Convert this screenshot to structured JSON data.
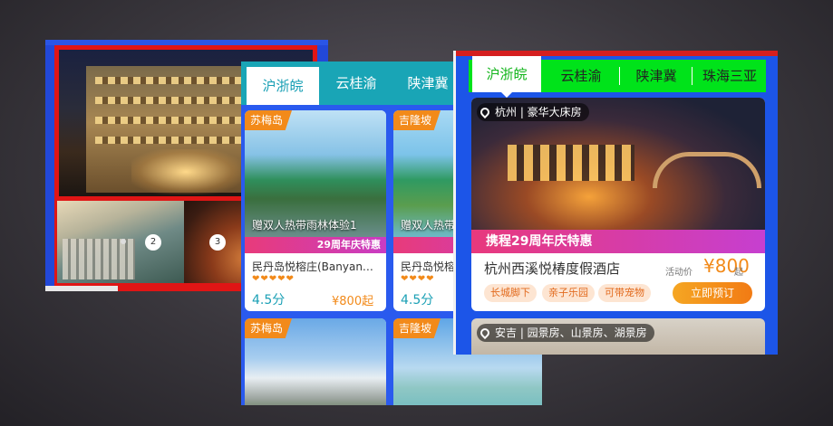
{
  "panel1": {
    "slider_indicators": [
      "2",
      "3"
    ]
  },
  "panel2": {
    "tabs": [
      {
        "label": "沪浙皖",
        "active": true
      },
      {
        "label": "云桂渝",
        "active": false
      },
      {
        "label": "陕津冀",
        "active": false
      }
    ],
    "cards": [
      {
        "tag": "苏梅岛",
        "overlay": "赠双人热带雨林体验1",
        "promo": "29周年庆特惠",
        "name": "民丹岛悦榕庄(Banyan…",
        "rating_hearts": "❤❤❤❤❤",
        "score": "4.5分",
        "price": "¥800起"
      },
      {
        "tag": "吉隆坡",
        "overlay": "赠双人热带",
        "promo": "",
        "name": "民丹岛悦榕",
        "rating_hearts": "❤❤❤❤",
        "score": "4.5分",
        "price": ""
      },
      {
        "tag": "苏梅岛"
      },
      {
        "tag": "吉隆坡"
      }
    ]
  },
  "panel3": {
    "tabs": [
      {
        "label": "沪浙皖",
        "active": true
      },
      {
        "label": "云桂渝",
        "active": false
      },
      {
        "label": "陕津冀",
        "active": false
      },
      {
        "label": "珠海三亚",
        "active": false
      }
    ],
    "card": {
      "location": "杭州 | 豪华大床房",
      "promo": "携程29周年庆特惠",
      "name": "杭州西溪悦椿度假酒店",
      "activity_label": "活动价",
      "price": "¥800",
      "price_suffix": "起",
      "tags": [
        "长城脚下",
        "亲子乐园",
        "可带宠物"
      ],
      "book_label": "立即预订"
    },
    "card2": {
      "location": "安吉 | 园景房、山景房、湖景房"
    }
  },
  "colors": {
    "blue": "#2a5aee",
    "teal_tab": "#19a5b6",
    "green_tab": "#00e31a",
    "orange": "#f28a1a",
    "red_border": "#e01515",
    "promo_pink": "#e8397c"
  },
  "icons": [
    "location-pin-icon",
    "heart-icon"
  ]
}
